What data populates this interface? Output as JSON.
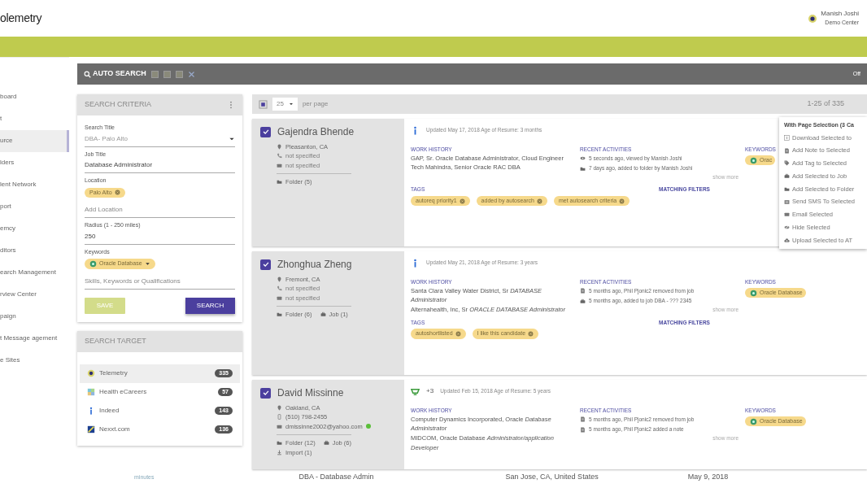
{
  "header": {
    "logo": "olemetry",
    "user_name": "Manish Joshi",
    "user_role": "Demo Center"
  },
  "sidebar": {
    "items": [
      {
        "label": "board",
        "selected": false
      },
      {
        "label": "t",
        "selected": false
      },
      {
        "label": "urce",
        "selected": true
      },
      {
        "label": "lders",
        "selected": false
      },
      {
        "label": "lent Network",
        "selected": false
      },
      {
        "label": "port",
        "selected": false
      },
      {
        "label": "emcy",
        "selected": false
      },
      {
        "label": "ditors",
        "selected": false
      },
      {
        "label": "earch Management",
        "selected": false
      },
      {
        "label": "rview Center",
        "selected": false
      },
      {
        "label": "paign",
        "selected": false
      },
      {
        "label": "t Message agement",
        "selected": false
      },
      {
        "label": "e Sites",
        "selected": false
      }
    ]
  },
  "auto_search": {
    "title": "AUTO SEARCH",
    "toggle": "Off"
  },
  "search_criteria": {
    "title": "SEARCH CRITERIA",
    "fields": [
      {
        "kind": "select",
        "label": "Search Title",
        "value": "DBA- Palo Alto"
      },
      {
        "kind": "text",
        "label": "Job Title",
        "value": "Database Administrator"
      },
      {
        "kind": "chips",
        "label": "Location",
        "chips": [
          "Palo Alto"
        ],
        "placeholder": "Add Location"
      },
      {
        "kind": "text",
        "label": "Radius (1 - 250 miles)",
        "value": "250"
      },
      {
        "kind": "keywords",
        "label": "Keywords",
        "chips": [
          "Oracle Database"
        ],
        "placeholder": "Skills, Keywords or Qualifications"
      }
    ],
    "save": {
      "label": "SAVE",
      "disabled": true
    },
    "search": {
      "label": "SEARCH"
    }
  },
  "search_target": {
    "title": "SEARCH TARGET",
    "items": [
      {
        "kind": "telemetry",
        "name": "Telemetry",
        "count": "335",
        "selected": true
      },
      {
        "kind": "health",
        "name": "Health eCareers",
        "count": "57",
        "selected": false
      },
      {
        "kind": "indeed",
        "name": "Indeed",
        "count": "143",
        "selected": false
      },
      {
        "kind": "nexxt",
        "name": "Nexxt.com",
        "count": "136",
        "selected": false
      }
    ]
  },
  "results_toolbar": {
    "page_size": "25",
    "per_page": "per page",
    "range": "1-25 of 335"
  },
  "candidates": [
    {
      "name": "Gajendra Bhende",
      "checked": true,
      "contacts": [
        {
          "kind": "location",
          "text": "Pleasanton, CA",
          "muted": false
        },
        {
          "kind": "phone",
          "text": "not specified",
          "muted": true
        },
        {
          "kind": "mail",
          "text": "not specified",
          "muted": true,
          "verified": false
        }
      ],
      "links": [
        {
          "kind": "folder",
          "label": "Folder (5)"
        }
      ],
      "kind": "indeed",
      "updated": "Updated May 17, 2018 Age of Resume: 3 months",
      "work_title": "WORK HISTORY",
      "work_history": [
        "GAP, Sr. Oracle Database Administrator, Cloud Engineer",
        "Tech Mahindra, Senior Oracle RAC DBA"
      ],
      "tags_title": "TAGS",
      "tags": [
        "autoreq priority1",
        "added by autosearch",
        "met autosearch criteria"
      ],
      "activities_title": "RECENT ACTIVITIES",
      "activities": [
        {
          "kind": "view",
          "text": "5 seconds ago, viewed by Manish Joshi"
        },
        {
          "kind": "folder",
          "text": "7 days ago, added to folder by Manish Joshi"
        }
      ],
      "show_more": "show more",
      "filters_title": "MATCHING FILTERS",
      "keywords_title": "KEYWORDS",
      "keywords": [
        "Orac"
      ]
    },
    {
      "name": "Zhonghua Zheng",
      "checked": true,
      "contacts": [
        {
          "kind": "location",
          "text": "Fremont, CA",
          "muted": false
        },
        {
          "kind": "phone",
          "text": "not specified",
          "muted": true
        },
        {
          "kind": "mail",
          "text": "not specified",
          "muted": true,
          "verified": false
        }
      ],
      "links": [
        {
          "kind": "folder",
          "label": "Folder (6)"
        },
        {
          "kind": "job",
          "label": "Job (1)"
        }
      ],
      "kind": "indeed",
      "updated": "Updated May 21, 2018 Age of Resume: 3 years",
      "work_title": "WORK HISTORY",
      "work_history": [
        "Santa Clara Valley Water District, Sr *DATABASE Administrator*",
        "Alternahealth, Inc, Sr *ORACLE DATABASE Administrator*"
      ],
      "tags_title": "TAGS",
      "tags": [
        "autoshortlisted",
        "I like this candidate"
      ],
      "activities_title": "RECENT ACTIVITIES",
      "activities": [
        {
          "kind": "note",
          "text": "5 months ago, Phil Pjonic2 removed from job"
        },
        {
          "kind": "job",
          "text": "5 months ago, added to job DBA - ??? 2345"
        }
      ],
      "show_more": "show more",
      "filters_title": "MATCHING FILTERS",
      "keywords_title": "KEYWORDS",
      "keywords": [
        "Oracle Database"
      ]
    },
    {
      "name": "David Missinne",
      "checked": true,
      "contacts": [
        {
          "kind": "location",
          "text": "Oakland, CA",
          "muted": false
        },
        {
          "kind": "mobile",
          "text": "(510) 798-2455",
          "muted": false
        },
        {
          "kind": "mail",
          "text": "dmissinne2002@yahoo.com",
          "muted": false,
          "verified": true
        }
      ],
      "links": [
        {
          "kind": "folder",
          "label": "Folder (12)"
        },
        {
          "kind": "job",
          "label": "Job (6)"
        },
        {
          "kind": "import",
          "label": "Import (1)"
        }
      ],
      "kind": "telemetry",
      "extra": "+3",
      "updated": "Updated Feb 15, 2018 Age of Resume: 5 years",
      "work_title": "WORK HISTORY",
      "work_history": [
        "Computer Dynamics Incorporated, Oracle *Database Administrator*",
        "MIDCOM, Oracle Database *Administrator/application Developer*"
      ],
      "activities_title": "RECENT ACTIVITIES",
      "activities": [
        {
          "kind": "note",
          "text": "5 months ago, Phil Pjonic2 removed from job"
        },
        {
          "kind": "note",
          "text": "5 months ago, Phil Pjonic2 added a note"
        }
      ],
      "show_more": "show more",
      "keywords_title": "KEYWORDS",
      "keywords": [
        "Oracle Database"
      ]
    }
  ],
  "bulk_menu": {
    "title": "With Page Selection (3 Ca",
    "items": [
      {
        "kind": "download",
        "label": "Download Selected to"
      },
      {
        "kind": "note",
        "label": "Add Note to Selected"
      },
      {
        "kind": "tag",
        "label": "Add Tag to Selected"
      },
      {
        "kind": "job",
        "label": "Add Selected to Job"
      },
      {
        "kind": "folder",
        "label": "Add Selected to Folder"
      },
      {
        "kind": "sms",
        "label": "Send SMS To Selected"
      },
      {
        "kind": "mail",
        "label": "Email Selected"
      },
      {
        "kind": "hide",
        "label": "Hide Selected"
      },
      {
        "kind": "upload",
        "label": "Upload Selected to AT"
      }
    ]
  },
  "footer": [
    "minutes",
    "DBA - Database Admin",
    "San Jose, CA, United States",
    "May 9, 2018"
  ]
}
